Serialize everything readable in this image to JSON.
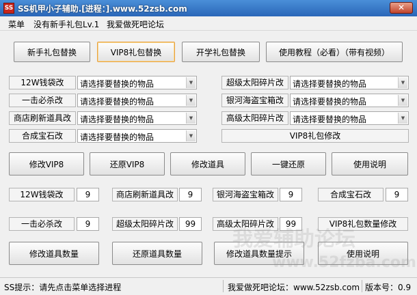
{
  "window": {
    "title": "SS机甲小子辅助.[进程：].www.52zsb.com",
    "icon": "app-icon",
    "close_label": "✕"
  },
  "menu": {
    "items": [
      "菜单",
      "没有新手礼包Lv.1",
      "我爱做死吧论坛"
    ]
  },
  "top_buttons": [
    "新手礼包替换",
    "VIP8礼包替换",
    "开学礼包替换",
    "使用教程（必看）（带有视频）"
  ],
  "combo_rows": {
    "left": [
      {
        "label": "12W钱袋改",
        "value": "请选择要替换的物品"
      },
      {
        "label": "一击必杀改",
        "value": "请选择要替换的物品"
      },
      {
        "label": "商店刷新道具改",
        "value": "请选择要替换的物品"
      },
      {
        "label": "合成宝石改",
        "value": "请选择要替换的物品"
      }
    ],
    "right": [
      {
        "label": "超级太阳碎片改",
        "value": "请选择要替换的物品"
      },
      {
        "label": "银河海盗宝箱改",
        "value": "请选择要替换的物品"
      },
      {
        "label": "高级太阳碎片改",
        "value": "请选择要替换的物品"
      }
    ],
    "vip_mod_label": "VIP8礼包修改"
  },
  "mid_buttons": [
    "修改VIP8",
    "还原VIP8",
    "修改道具",
    "一键还原",
    "使用说明"
  ],
  "num_rows": [
    [
      {
        "label": "12W钱袋改",
        "value": "9"
      },
      {
        "label": "商店刷新道具改",
        "value": "9"
      },
      {
        "label": "银河海盗宝箱改",
        "value": "9"
      },
      {
        "label": "合成宝石改",
        "value": "9"
      }
    ],
    [
      {
        "label": "一击必杀改",
        "value": "9"
      },
      {
        "label": "超级太阳碎片改",
        "value": "99"
      },
      {
        "label": "高级太阳碎片改",
        "value": "99"
      }
    ]
  ],
  "vip_count_label": "VIP8礼包数量修改",
  "bottom_buttons": [
    "修改道具数量",
    "还原道具数量",
    "修改道具数量提示",
    "使用说明"
  ],
  "status": {
    "hint": "SS提示：请先点击菜单选择进程",
    "forum": "我爱做死吧论坛：www.52zsb.com",
    "version": "版本号：0.9"
  },
  "watermark": {
    "line1": "我爱辅助论坛",
    "line2": "www.52fzba.com"
  }
}
